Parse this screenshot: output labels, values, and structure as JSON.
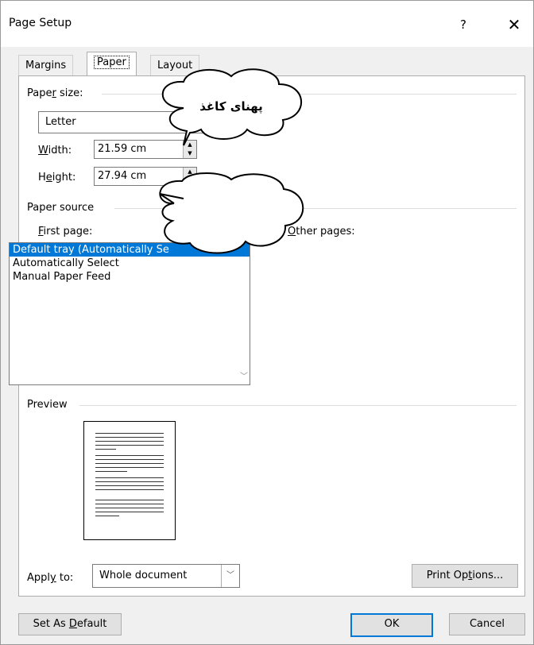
{
  "window": {
    "title": "Page Setup",
    "help": "?",
    "close": "✕"
  },
  "tabs": [
    {
      "label": "Margins"
    },
    {
      "label": "Paper"
    },
    {
      "label": "Layout"
    }
  ],
  "paper_size": {
    "group_label_pre": "Pape",
    "group_label_u": "r",
    "group_label_post": " size:",
    "selected": "Letter",
    "width_label_u": "W",
    "width_label_post": "idth:",
    "width_value": "21.59 cm",
    "height_label_pre": "H",
    "height_label_u": "e",
    "height_label_post": "ight:",
    "height_value": "27.94 cm"
  },
  "paper_source": {
    "group_label": "Paper source",
    "first_page_u": "F",
    "first_page_post": "irst page:",
    "other_pages_u": "O",
    "other_pages_post": "ther pages:",
    "first_page_items": [
      "Default tray (Automatically Se",
      "Automatically Select",
      "Manual Paper Feed"
    ]
  },
  "preview": {
    "label": "Preview"
  },
  "apply_to": {
    "label_pre": "Appl",
    "label_u": "y",
    "label_post": " to:",
    "value": "Whole document"
  },
  "buttons": {
    "print_options_pre": "Print Op",
    "print_options_u": "t",
    "print_options_post": "ions...",
    "set_default_pre": "Set As ",
    "set_default_u": "D",
    "set_default_post": "efault",
    "ok": "OK",
    "cancel": "Cancel"
  },
  "callouts": {
    "bubble1_text": "پهنای کاغذ",
    "bubble2_text": ""
  }
}
